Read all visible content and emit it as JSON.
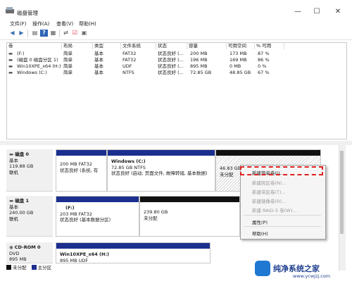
{
  "window": {
    "title": "磁盘管理",
    "controls": {
      "minimize": "—",
      "maximize": "☐",
      "close": "✕"
    }
  },
  "menu": [
    "文件(F)",
    "操作(A)",
    "查看(V)",
    "帮助(H)"
  ],
  "volume_table": {
    "columns": [
      "卷",
      "布局",
      "类型",
      "文件系统",
      "状态",
      "容量",
      "可用空间",
      "% 可用"
    ],
    "rows": [
      [
        "(F:)",
        "简单",
        "基本",
        "FAT32",
        "状态良好 (...",
        "200 MB",
        "173 MB",
        "87 %"
      ],
      [
        "(磁盘 0 磁盘分区 1)",
        "简单",
        "基本",
        "FAT32",
        "状态良好 (...",
        "196 MB",
        "169 MB",
        "86 %"
      ],
      [
        "Win10XPE_x64 (H:)",
        "简单",
        "基本",
        "UDF",
        "状态良好 (...",
        "895 MB",
        "0 MB",
        "0 %"
      ],
      [
        "Windows (C:)",
        "简单",
        "基本",
        "NTFS",
        "状态良好 (...",
        "72.85 GB",
        "48.85 GB",
        "67 %"
      ]
    ]
  },
  "disks": {
    "disk0": {
      "name": "磁盘 0",
      "type": "基本",
      "size": "119.88 GB",
      "status": "联机",
      "p1": {
        "line1": "200 MB FAT32",
        "line2": "状态良好 (系统, 有"
      },
      "p2": {
        "title": "Windows  (C:)",
        "line1": "72.85 GB NTFS",
        "line2": "状态良好 (启动, 页面文件, 故障转储, 基本数据)"
      },
      "p3": {
        "line1": "46.83 GB",
        "line2": "未分配"
      }
    },
    "disk1": {
      "name": "磁盘 1",
      "type": "基本",
      "size": "240.00 GB",
      "status": "联机",
      "p1": {
        "title": "(F:)",
        "line1": "203 MB FAT32",
        "line2": "状态良好 (基本数据分区)"
      },
      "p2": {
        "line1": "239.80 GB",
        "line2": "未分配"
      }
    },
    "cdrom0": {
      "name": "CD-ROM 0",
      "type": "DVD",
      "size": "895 MB",
      "status": "联机",
      "p1": {
        "title": "Win10XPE_x64  (H:)",
        "line1": "895 MB UDF"
      }
    }
  },
  "legend": {
    "unallocated": "未分配",
    "primary": "主分区"
  },
  "context_menu": {
    "items": [
      "新建简单卷(I)...",
      "新建跨区卷(N)...",
      "新建带区卷(T)...",
      "新建镜像卷(R)...",
      "新建 RAID-5 卷(W)...",
      "属性(P)",
      "帮助(H)"
    ]
  },
  "watermark": {
    "brand": "纯净系统之家",
    "url": "www.ycwjzj.com"
  },
  "colors": {
    "primary_partition": "#1c2f8f",
    "unallocated": "#111111",
    "highlight": "#e02020"
  }
}
